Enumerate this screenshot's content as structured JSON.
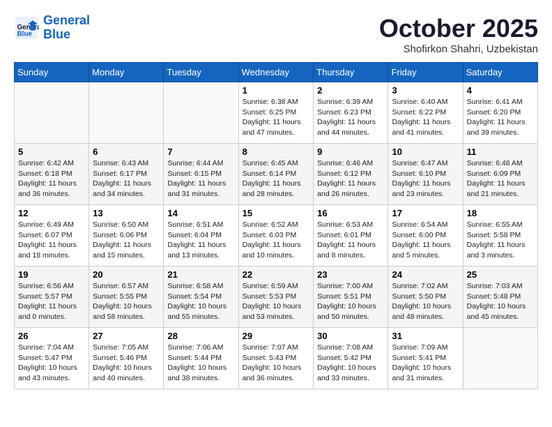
{
  "header": {
    "logo_line1": "General",
    "logo_line2": "Blue",
    "month": "October 2025",
    "location": "Shofirkon Shahri, Uzbekistan"
  },
  "weekdays": [
    "Sunday",
    "Monday",
    "Tuesday",
    "Wednesday",
    "Thursday",
    "Friday",
    "Saturday"
  ],
  "weeks": [
    [
      {
        "day": "",
        "info": ""
      },
      {
        "day": "",
        "info": ""
      },
      {
        "day": "",
        "info": ""
      },
      {
        "day": "1",
        "info": "Sunrise: 6:38 AM\nSunset: 6:25 PM\nDaylight: 11 hours\nand 47 minutes."
      },
      {
        "day": "2",
        "info": "Sunrise: 6:39 AM\nSunset: 6:23 PM\nDaylight: 11 hours\nand 44 minutes."
      },
      {
        "day": "3",
        "info": "Sunrise: 6:40 AM\nSunset: 6:22 PM\nDaylight: 11 hours\nand 41 minutes."
      },
      {
        "day": "4",
        "info": "Sunrise: 6:41 AM\nSunset: 6:20 PM\nDaylight: 11 hours\nand 39 minutes."
      }
    ],
    [
      {
        "day": "5",
        "info": "Sunrise: 6:42 AM\nSunset: 6:18 PM\nDaylight: 11 hours\nand 36 minutes."
      },
      {
        "day": "6",
        "info": "Sunrise: 6:43 AM\nSunset: 6:17 PM\nDaylight: 11 hours\nand 34 minutes."
      },
      {
        "day": "7",
        "info": "Sunrise: 6:44 AM\nSunset: 6:15 PM\nDaylight: 11 hours\nand 31 minutes."
      },
      {
        "day": "8",
        "info": "Sunrise: 6:45 AM\nSunset: 6:14 PM\nDaylight: 11 hours\nand 28 minutes."
      },
      {
        "day": "9",
        "info": "Sunrise: 6:46 AM\nSunset: 6:12 PM\nDaylight: 11 hours\nand 26 minutes."
      },
      {
        "day": "10",
        "info": "Sunrise: 6:47 AM\nSunset: 6:10 PM\nDaylight: 11 hours\nand 23 minutes."
      },
      {
        "day": "11",
        "info": "Sunrise: 6:48 AM\nSunset: 6:09 PM\nDaylight: 11 hours\nand 21 minutes."
      }
    ],
    [
      {
        "day": "12",
        "info": "Sunrise: 6:49 AM\nSunset: 6:07 PM\nDaylight: 11 hours\nand 18 minutes."
      },
      {
        "day": "13",
        "info": "Sunrise: 6:50 AM\nSunset: 6:06 PM\nDaylight: 11 hours\nand 15 minutes."
      },
      {
        "day": "14",
        "info": "Sunrise: 6:51 AM\nSunset: 6:04 PM\nDaylight: 11 hours\nand 13 minutes."
      },
      {
        "day": "15",
        "info": "Sunrise: 6:52 AM\nSunset: 6:03 PM\nDaylight: 11 hours\nand 10 minutes."
      },
      {
        "day": "16",
        "info": "Sunrise: 6:53 AM\nSunset: 6:01 PM\nDaylight: 11 hours\nand 8 minutes."
      },
      {
        "day": "17",
        "info": "Sunrise: 6:54 AM\nSunset: 6:00 PM\nDaylight: 11 hours\nand 5 minutes."
      },
      {
        "day": "18",
        "info": "Sunrise: 6:55 AM\nSunset: 5:58 PM\nDaylight: 11 hours\nand 3 minutes."
      }
    ],
    [
      {
        "day": "19",
        "info": "Sunrise: 6:56 AM\nSunset: 5:57 PM\nDaylight: 11 hours\nand 0 minutes."
      },
      {
        "day": "20",
        "info": "Sunrise: 6:57 AM\nSunset: 5:55 PM\nDaylight: 10 hours\nand 58 minutes."
      },
      {
        "day": "21",
        "info": "Sunrise: 6:58 AM\nSunset: 5:54 PM\nDaylight: 10 hours\nand 55 minutes."
      },
      {
        "day": "22",
        "info": "Sunrise: 6:59 AM\nSunset: 5:53 PM\nDaylight: 10 hours\nand 53 minutes."
      },
      {
        "day": "23",
        "info": "Sunrise: 7:00 AM\nSunset: 5:51 PM\nDaylight: 10 hours\nand 50 minutes."
      },
      {
        "day": "24",
        "info": "Sunrise: 7:02 AM\nSunset: 5:50 PM\nDaylight: 10 hours\nand 48 minutes."
      },
      {
        "day": "25",
        "info": "Sunrise: 7:03 AM\nSunset: 5:48 PM\nDaylight: 10 hours\nand 45 minutes."
      }
    ],
    [
      {
        "day": "26",
        "info": "Sunrise: 7:04 AM\nSunset: 5:47 PM\nDaylight: 10 hours\nand 43 minutes."
      },
      {
        "day": "27",
        "info": "Sunrise: 7:05 AM\nSunset: 5:46 PM\nDaylight: 10 hours\nand 40 minutes."
      },
      {
        "day": "28",
        "info": "Sunrise: 7:06 AM\nSunset: 5:44 PM\nDaylight: 10 hours\nand 38 minutes."
      },
      {
        "day": "29",
        "info": "Sunrise: 7:07 AM\nSunset: 5:43 PM\nDaylight: 10 hours\nand 36 minutes."
      },
      {
        "day": "30",
        "info": "Sunrise: 7:08 AM\nSunset: 5:42 PM\nDaylight: 10 hours\nand 33 minutes."
      },
      {
        "day": "31",
        "info": "Sunrise: 7:09 AM\nSunset: 5:41 PM\nDaylight: 10 hours\nand 31 minutes."
      },
      {
        "day": "",
        "info": ""
      }
    ]
  ]
}
